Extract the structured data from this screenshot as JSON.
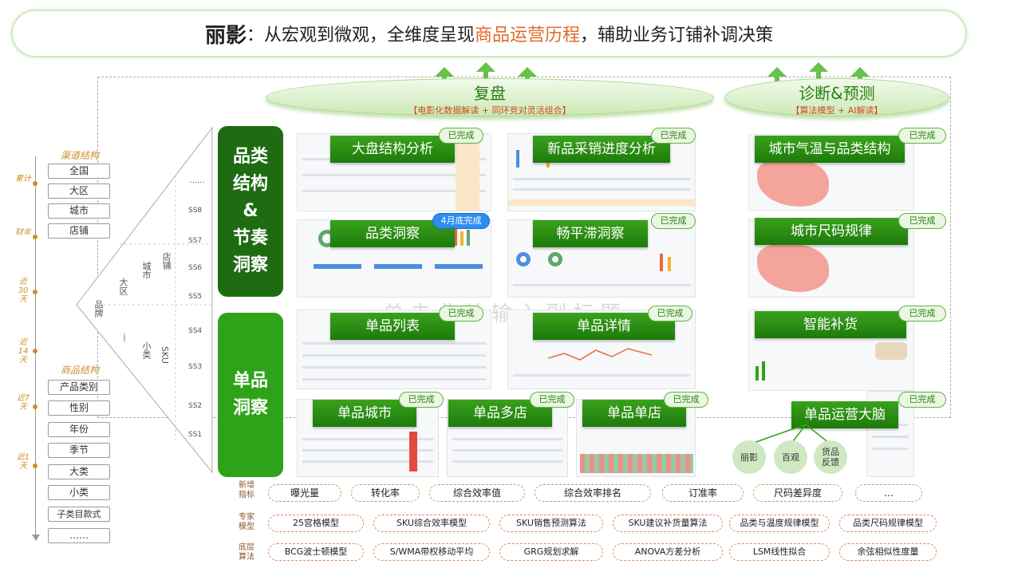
{
  "header": {
    "brand": "丽影",
    "pre": "：从宏观到微观，全维度呈现",
    "highlight": "商品运营历程",
    "post": "，辅助业务订铺补调决策"
  },
  "sections": {
    "review": {
      "title": "复盘",
      "subtitle": "【电影化数据解读 + 同环竞对灵活组合】"
    },
    "diagnose": {
      "title": "诊断&预测",
      "subtitle": "【算法模型 + AI解读】"
    }
  },
  "timeline": {
    "labels": [
      "累计",
      "财年",
      "近30天",
      "近14天",
      "近7天",
      "近1天"
    ]
  },
  "channel_structure": {
    "title": "渠道结构",
    "items": [
      "全国",
      "大区",
      "城市",
      "店铺"
    ]
  },
  "product_structure": {
    "title": "商品结构",
    "items": [
      "产品类别",
      "性别",
      "年份",
      "季节",
      "大类",
      "小类",
      "子类目款式",
      "……"
    ]
  },
  "pyramid": {
    "brand": "品牌",
    "region": "大区",
    "city": "城市",
    "store": "店铺",
    "subcat": "小类",
    "sku": "SKU",
    "dash": "—",
    "dots": "……",
    "ss_levels": [
      "SS8",
      "SS7",
      "SS6",
      "SS5",
      "SS4",
      "SS3",
      "SS2",
      "SS1"
    ]
  },
  "blocks": {
    "category": "品类\n结构\n&\n节奏\n洞察",
    "item": "单品\n洞察"
  },
  "modules": [
    {
      "label": "大盘结构分析",
      "status": "已完成"
    },
    {
      "label": "新品采销进度分析",
      "status": "已完成"
    },
    {
      "label": "品类洞察",
      "status": "4月底完成"
    },
    {
      "label": "畅平滞洞察",
      "status": "已完成"
    },
    {
      "label": "单品列表",
      "status": "已完成"
    },
    {
      "label": "单品详情",
      "status": "已完成"
    },
    {
      "label": "单品城市",
      "status": "已完成"
    },
    {
      "label": "单品多店",
      "status": "已完成"
    },
    {
      "label": "单品单店",
      "status": "已完成"
    },
    {
      "label": "城市气温与品类结构",
      "status": "已完成"
    },
    {
      "label": "城市尺码规律",
      "status": "已完成"
    },
    {
      "label": "智能补货",
      "status": "已完成"
    },
    {
      "label": "单品运营大脑",
      "status": "已完成"
    }
  ],
  "brain_inputs": [
    "丽影",
    "百观",
    "货品\n反馈"
  ],
  "watermark": "单击此处输入副标题",
  "new_metrics": {
    "label": "新增\n指标",
    "items": [
      "曝光量",
      "转化率",
      "综合效率值",
      "综合效率排名",
      "订准率",
      "尺码差异度",
      "…"
    ]
  },
  "expert_models": {
    "label": "专家\n模型",
    "items": [
      "25宫格模型",
      "SKU综合效率模型",
      "SKU销售预测算法",
      "SKU建议补货量算法",
      "品类与温度规律模型",
      "品类尺码规律模型"
    ]
  },
  "base_algorithms": {
    "label": "底层\n算法",
    "items": [
      "BCG波士顿模型",
      "S/WMA带权移动平均",
      "GRG规划求解",
      "ANOVA方差分析",
      "LSM线性拟合",
      "余弦相似性度量"
    ]
  },
  "colors": {
    "dark_green": "#1e6b12",
    "bright_green": "#2ea31a",
    "accent_orange": "#e06b2a",
    "gold": "#c8912b"
  }
}
